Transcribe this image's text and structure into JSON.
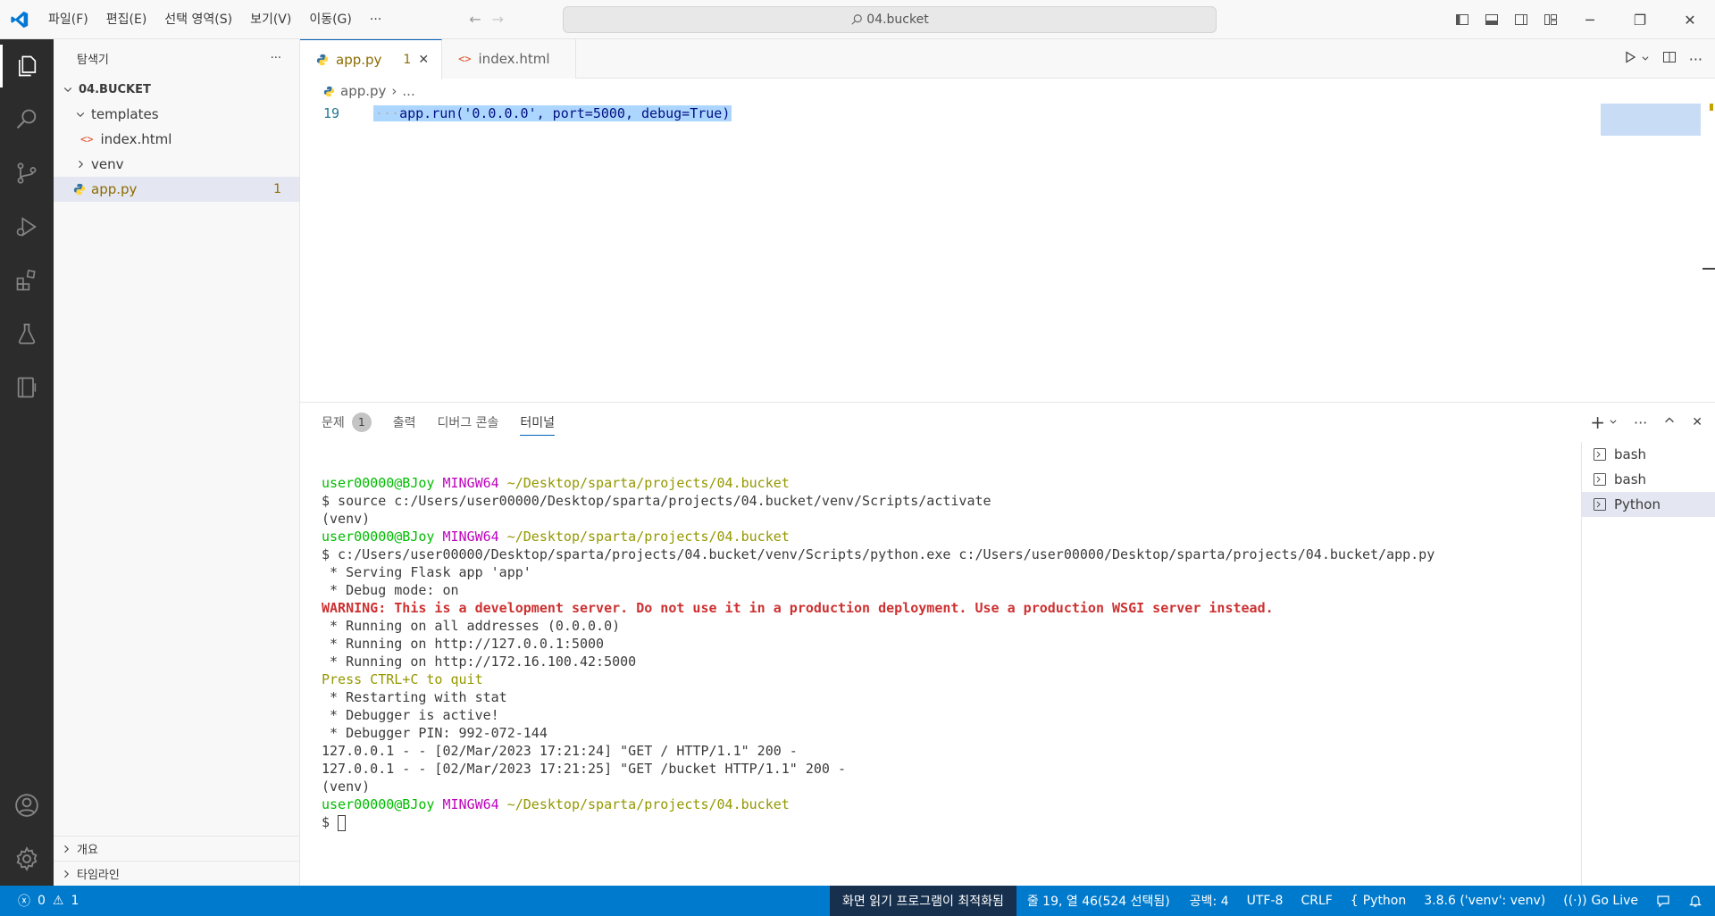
{
  "titlebar": {
    "menus": [
      "파일(F)",
      "편집(E)",
      "선택 영역(S)",
      "보기(V)",
      "이동(G)",
      "···"
    ],
    "search_text": "04.bucket"
  },
  "sidebar": {
    "title": "탐색기",
    "more": "···",
    "root": "04.BUCKET",
    "items": [
      {
        "label": "templates",
        "type": "folder-open"
      },
      {
        "label": "index.html",
        "type": "html-file"
      },
      {
        "label": "venv",
        "type": "folder-closed"
      },
      {
        "label": "app.py",
        "type": "python-file",
        "badge": "1"
      }
    ],
    "outline": "개요",
    "timeline": "타임라인"
  },
  "editor": {
    "tabs": [
      {
        "label": "app.py",
        "badge": "1",
        "active": true
      },
      {
        "label": "index.html",
        "active": false
      }
    ],
    "breadcrumb": [
      "app.py",
      "..."
    ],
    "line_number": "19",
    "code": "app.run('0.0.0.0', port=5000, debug=True)"
  },
  "panel": {
    "tabs": [
      {
        "label": "문제",
        "badge": "1"
      },
      {
        "label": "출력"
      },
      {
        "label": "디버그 콘솔"
      },
      {
        "label": "터미널"
      }
    ],
    "terminal_list": [
      "bash",
      "bash",
      "Python"
    ],
    "prompt_user": "user00000@BJoy",
    "prompt_host": "MINGW64",
    "prompt_path": "~/Desktop/sparta/projects/04.bucket",
    "lines": {
      "l2": "$ source c:/Users/user00000/Desktop/sparta/projects/04.bucket/venv/Scripts/activate",
      "l3": "(venv)",
      "l5": "$ c:/Users/user00000/Desktop/sparta/projects/04.bucket/venv/Scripts/python.exe c:/Users/user00000/Desktop/sparta/projects/04.bucket/app.py",
      "l6": " * Serving Flask app 'app'",
      "l7": " * Debug mode: on",
      "l8": "WARNING: This is a development server. Do not use it in a production deployment. Use a production WSGI server instead.",
      "l9": " * Running on all addresses (0.0.0.0)",
      "l10": " * Running on http://127.0.0.1:5000",
      "l11": " * Running on http://172.16.100.42:5000",
      "l12": "Press CTRL+C to quit",
      "l13": " * Restarting with stat",
      "l14": " * Debugger is active!",
      "l15": " * Debugger PIN: 992-072-144",
      "l16": "127.0.0.1 - - [02/Mar/2023 17:21:24] \"GET / HTTP/1.1\" 200 -",
      "l17": "127.0.0.1 - - [02/Mar/2023 17:21:25] \"GET /bucket HTTP/1.1\" 200 -",
      "l18": "(venv)",
      "l20": "$ "
    }
  },
  "statusbar": {
    "errors": "0",
    "warnings": "1",
    "screen_reader": "화면 읽기 프로그램이 최적화됨",
    "position": "줄 19, 열 46(524 선택됨)",
    "spaces": "공백: 4",
    "encoding": "UTF-8",
    "eol": "CRLF",
    "language": "Python",
    "interpreter": "3.8.6 ('venv': venv)",
    "golive": "Go Live"
  }
}
